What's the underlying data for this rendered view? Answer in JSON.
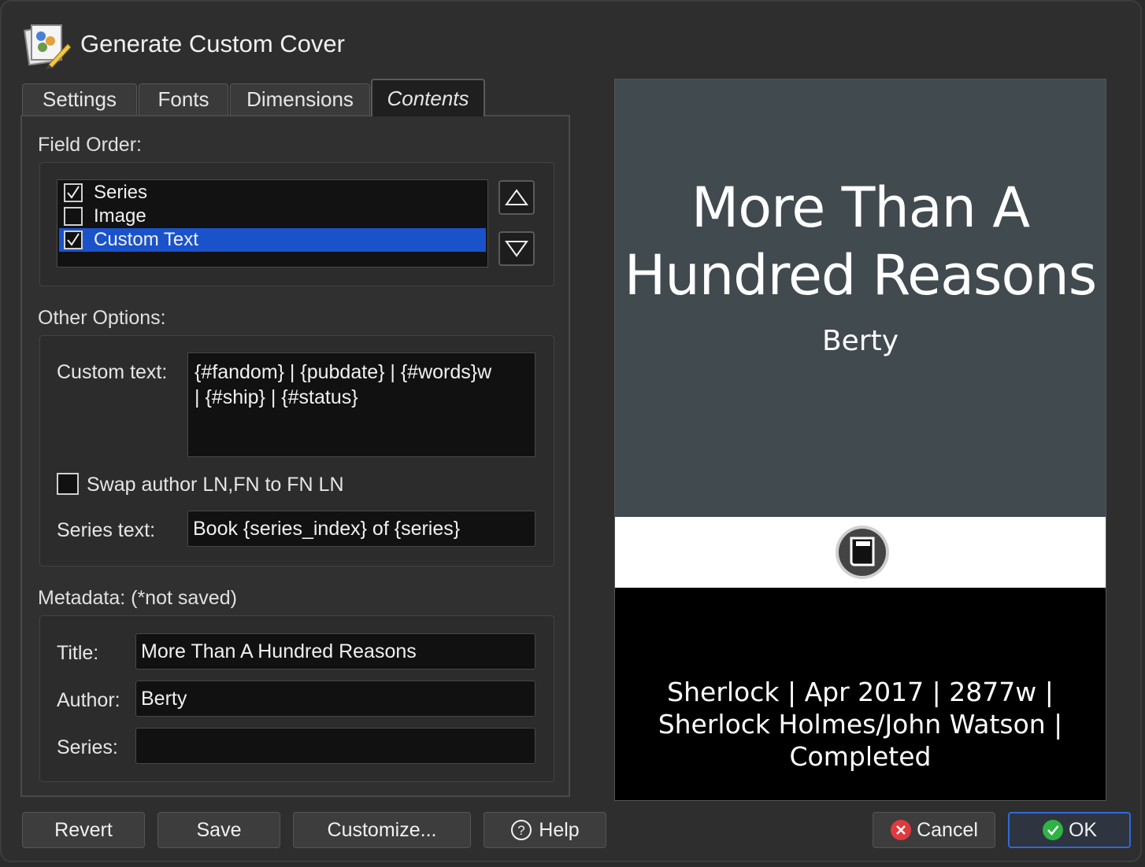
{
  "window": {
    "title": "Generate Custom Cover",
    "icon": "palette-edit-icon"
  },
  "tabs": [
    {
      "label": "Settings",
      "active": false
    },
    {
      "label": "Fonts",
      "active": false
    },
    {
      "label": "Dimensions",
      "active": false
    },
    {
      "label": "Contents",
      "active": true
    }
  ],
  "contents": {
    "field_order_label": "Field Order:",
    "field_order": [
      {
        "label": "Series",
        "checked": true,
        "selected": false
      },
      {
        "label": "Image",
        "checked": false,
        "selected": false
      },
      {
        "label": "Custom Text",
        "checked": true,
        "selected": true
      }
    ],
    "other_options_label": "Other Options:",
    "custom_text_label": "Custom text:",
    "custom_text_line1": "{#fandom} | {pubdate} |  {#words}w",
    "custom_text_line2": "| {#ship} | {#status}",
    "swap_author_label": "Swap author LN,FN to FN LN",
    "swap_author_checked": false,
    "series_text_label": "Series text:",
    "series_text_value": "Book {series_index} of {series}",
    "metadata_label": "Metadata: (*not saved)",
    "title_label": "Title:",
    "title_value": "More Than A Hundred Reasons",
    "author_label": "Author:",
    "author_value": "Berty",
    "series_label": "Series:",
    "series_value": ""
  },
  "preview": {
    "title_line1": "More Than A",
    "title_line2": "Hundred Reasons",
    "author": "Berty",
    "custom_line1": "Sherlock | Apr 2017 | 2877w |",
    "custom_line2": "Sherlock Holmes/John Watson |",
    "custom_line3": "Completed",
    "logo": "book-logo-icon"
  },
  "buttons": {
    "revert": "Revert",
    "save": "Save",
    "customize": "Customize...",
    "help": "Help",
    "cancel": "Cancel",
    "ok": "OK"
  },
  "colors": {
    "selection": "#1a53c9",
    "cover_top": "#404a4f",
    "ok_border": "#2f6ad8",
    "cancel_icon": "#e0393e",
    "ok_icon": "#2fb344"
  }
}
